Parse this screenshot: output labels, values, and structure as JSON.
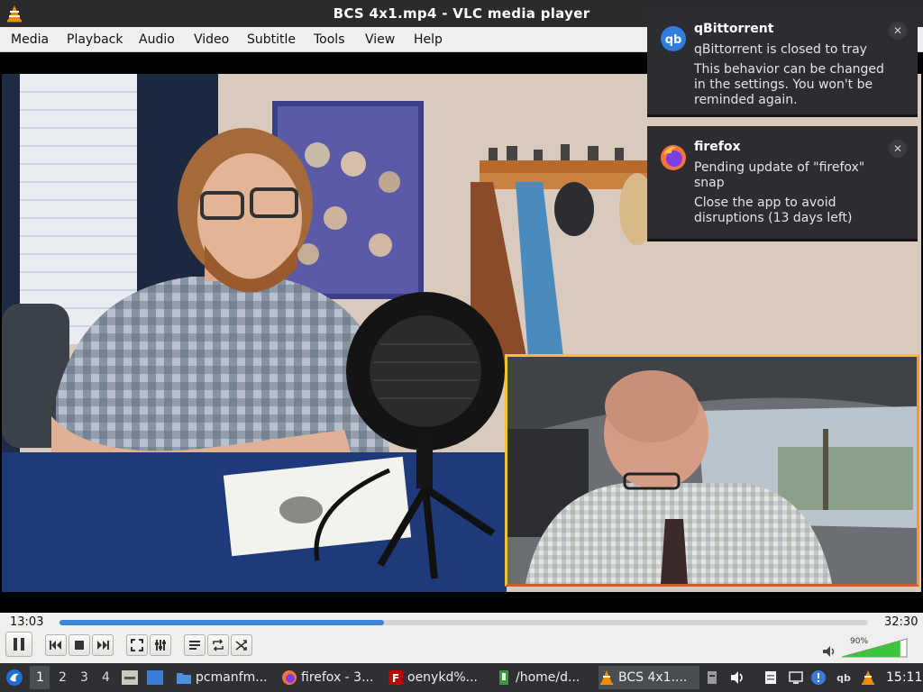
{
  "window": {
    "title": "BCS 4x1.mp4 - VLC media player",
    "menu": [
      "Media",
      "Playback",
      "Audio",
      "Video",
      "Subtitle",
      "Tools",
      "View",
      "Help"
    ]
  },
  "player": {
    "elapsed": "13:03",
    "total": "32:30",
    "progress_fraction": 0.401,
    "volume_label": "90%",
    "volume_fraction": 0.9
  },
  "notifications": [
    {
      "app": "qBittorrent",
      "icon": "qbittorrent-icon",
      "line1": "qBittorrent is closed to tray",
      "line2": "This behavior can be changed in the settings. You won't be reminded again."
    },
    {
      "app": "firefox",
      "icon": "firefox-icon",
      "line1": "Pending update of \"firefox\" snap",
      "line2": "Close the app to avoid disruptions (13 days left)"
    }
  ],
  "taskbar": {
    "workspaces": [
      "1",
      "2",
      "3",
      "4"
    ],
    "tasks": [
      {
        "label": "pcmanfm...",
        "icon": "folder-icon"
      },
      {
        "label": "firefox - 3...",
        "icon": "firefox-icon"
      },
      {
        "label": "oenykd%...",
        "icon": "filezilla-icon"
      },
      {
        "label": "/home/d...",
        "icon": "terminal-icon"
      },
      {
        "label": "BCS 4x1....",
        "icon": "vlc-icon"
      }
    ],
    "clock": "15:11"
  },
  "colors": {
    "vlc_orange": "#f08c00",
    "seek_blue": "#3b84d6",
    "volume_green": "#3cc43c",
    "pip_border": "#f2c230"
  }
}
